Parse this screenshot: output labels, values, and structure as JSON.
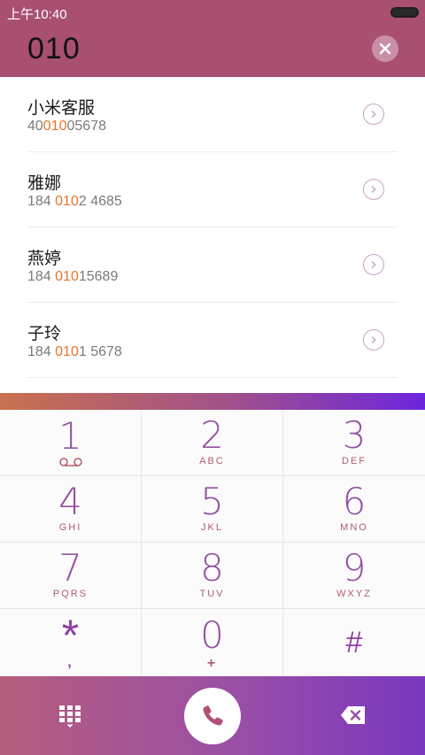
{
  "status_bar": {
    "time": "上午10:40"
  },
  "dialer": {
    "input": "010"
  },
  "results": [
    {
      "name": "小米客服",
      "number_before": "40",
      "number_match": "010",
      "number_after": "05678"
    },
    {
      "name": "雅娜",
      "number_before": "184 ",
      "number_match": "010",
      "number_after": "2 4685"
    },
    {
      "name": "燕婷",
      "number_before": "184 ",
      "number_match": "010",
      "number_after": "15689"
    },
    {
      "name": "子玲",
      "number_before": "184 ",
      "number_match": "010",
      "number_after": "1 5678"
    }
  ],
  "keypad": [
    {
      "digit": "1",
      "letters": ""
    },
    {
      "digit": "2",
      "letters": "ABC"
    },
    {
      "digit": "3",
      "letters": "DEF"
    },
    {
      "digit": "4",
      "letters": "GHI"
    },
    {
      "digit": "5",
      "letters": "JKL"
    },
    {
      "digit": "6",
      "letters": "MNO"
    },
    {
      "digit": "7",
      "letters": "PQRS"
    },
    {
      "digit": "8",
      "letters": "TUV"
    },
    {
      "digit": "9",
      "letters": "WXYZ"
    },
    {
      "digit": "*",
      "letters": ","
    },
    {
      "digit": "0",
      "letters": "+"
    },
    {
      "digit": "#",
      "letters": ""
    }
  ],
  "icons": {
    "clear": "close-circle-icon",
    "detail": "chevron-right-circle-icon",
    "voicemail": "voicemail-icon",
    "dialpad": "dialpad-icon",
    "call": "phone-icon",
    "backspace": "backspace-icon"
  },
  "colors": {
    "header": "#a84f72",
    "match_highlight": "#e8742a",
    "digit": "#9252a3",
    "call_icon": "#b0517a"
  }
}
